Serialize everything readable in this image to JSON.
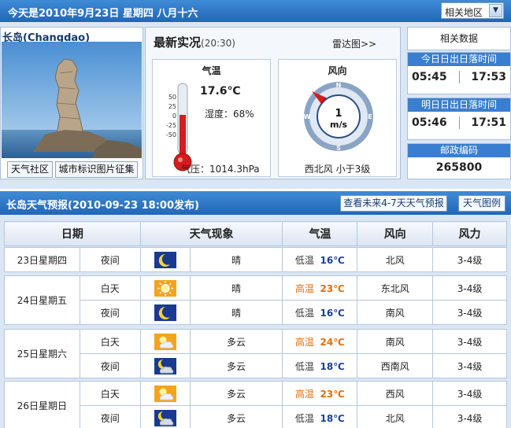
{
  "header": {
    "date_text": "今天是2010年9月23日  星期四  八月十六",
    "region_select": "相关地区"
  },
  "city": {
    "name": "长岛(Changdao)",
    "btn_community": "天气社区",
    "btn_photo": "城市标识图片征集"
  },
  "latest": {
    "title": "最新实况",
    "time": "(20:30)",
    "radar_link": "雷达图>>",
    "temp_label": "气温",
    "temp_value": "17.6℃",
    "humidity": "湿度：68%",
    "pressure": "气压：1014.3hPa",
    "thermo_scale": [
      "50",
      "25",
      "0",
      "-25",
      "-50"
    ],
    "wind_label": "风向",
    "wind_speed": "1",
    "wind_unit": "m/s",
    "wind_desc": "西北风  小于3级",
    "compass": [
      "N",
      "E",
      "S",
      "W"
    ]
  },
  "related": {
    "title": "相关数据",
    "today_label": "今日日出日落时间",
    "today_sunrise": "05:45",
    "today_sunset": "17:53",
    "tomorrow_label": "明日日出日落时间",
    "tomorrow_sunrise": "05:46",
    "tomorrow_sunset": "17:51",
    "postcode_label": "邮政编码",
    "postcode": "265800"
  },
  "forecast": {
    "title": "长岛天气预报(2010-09-23  18:00发布)",
    "btn_future": "查看未来4-7天天气预报",
    "btn_legend": "天气图例",
    "columns": [
      "日期",
      "天气现象",
      "气温",
      "风向",
      "风力"
    ],
    "temp_high_label": "高温",
    "temp_low_label": "低温",
    "days": [
      {
        "date": "23日星期四",
        "rows": [
          {
            "period": "夜间",
            "icon": "moon-icon",
            "weather": "晴",
            "temp_type": "低温",
            "temp": "16℃",
            "wind_dir": "北风",
            "wind_force": "3-4级"
          }
        ]
      },
      {
        "date": "24日星期五",
        "rows": [
          {
            "period": "白天",
            "icon": "sun-icon",
            "weather": "晴",
            "temp_type": "高温",
            "temp": "23℃",
            "wind_dir": "东北风",
            "wind_force": "3-4级"
          },
          {
            "period": "夜间",
            "icon": "moon-icon",
            "weather": "晴",
            "temp_type": "低温",
            "temp": "16℃",
            "wind_dir": "南风",
            "wind_force": "3-4级"
          }
        ]
      },
      {
        "date": "25日星期六",
        "rows": [
          {
            "period": "白天",
            "icon": "sun-cloud-icon",
            "weather": "多云",
            "temp_type": "高温",
            "temp": "24℃",
            "wind_dir": "南风",
            "wind_force": "3-4级"
          },
          {
            "period": "夜间",
            "icon": "moon-cloud-icon",
            "weather": "多云",
            "temp_type": "低温",
            "temp": "18℃",
            "wind_dir": "西南风",
            "wind_force": "3-4级"
          }
        ]
      },
      {
        "date": "26日星期日",
        "rows": [
          {
            "period": "白天",
            "icon": "sun-cloud-icon",
            "weather": "多云",
            "temp_type": "高温",
            "temp": "23℃",
            "wind_dir": "西风",
            "wind_force": "3-4级"
          },
          {
            "period": "夜间",
            "icon": "moon-cloud-icon",
            "weather": "多云",
            "temp_type": "低温",
            "temp": "18℃",
            "wind_dir": "北风",
            "wind_force": "3-4级"
          }
        ]
      }
    ]
  }
}
